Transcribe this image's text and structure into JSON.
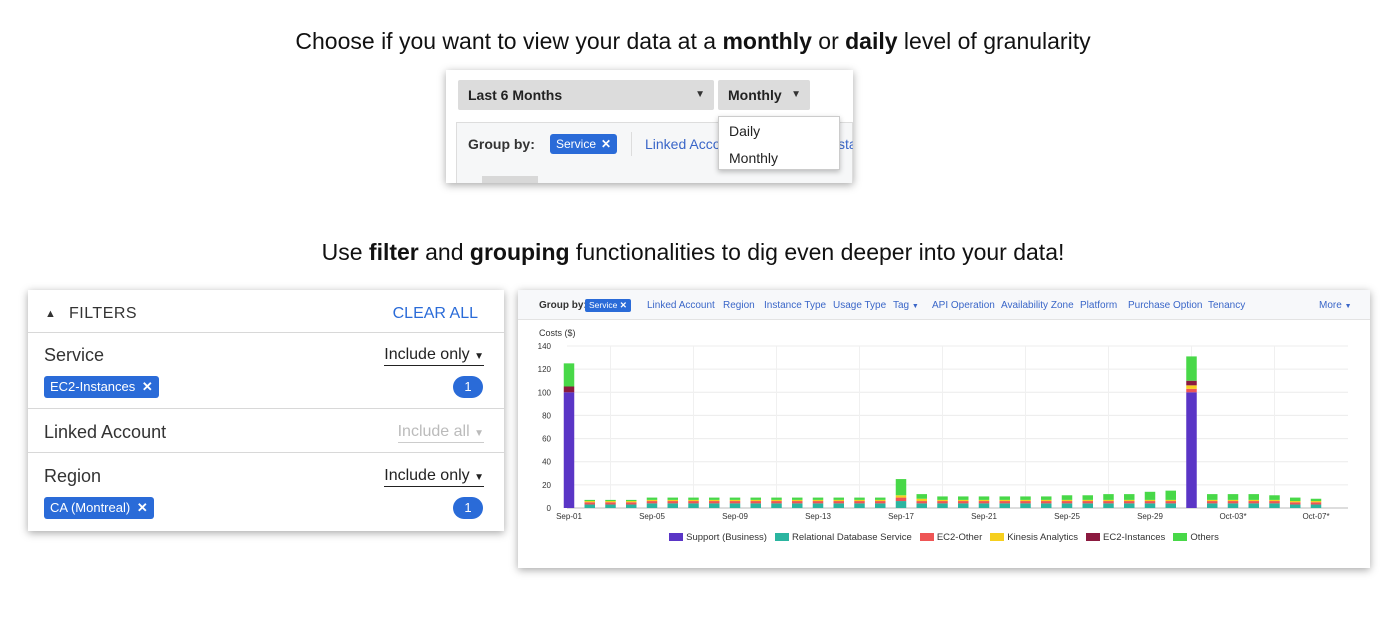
{
  "caption1": {
    "pre": "Choose if you want to view your data at a ",
    "b1": "monthly",
    "mid": " or ",
    "b2": "daily",
    "post": " level of granularity"
  },
  "caption2": {
    "pre": "Use ",
    "b1": "filter",
    "mid": " and ",
    "b2": "grouping",
    "post": " functionalities to dig even deeper into your data!"
  },
  "granularity_panel": {
    "range_label": "Last 6 Months",
    "granularity_label": "Monthly",
    "group_by_label": "Group by:",
    "chip_label": "Service",
    "linked_account_label": "Linked Acco",
    "cut_text": "sta",
    "menu_options": [
      "Daily",
      "Monthly"
    ]
  },
  "filters": {
    "header": "FILTERS",
    "clear_all": "CLEAR ALL",
    "service": {
      "label": "Service",
      "dropdown": "Include only",
      "chip": "EC2-Instances",
      "count": "1"
    },
    "linked_account": {
      "label": "Linked Account",
      "dropdown": "Include all"
    },
    "region": {
      "label": "Region",
      "dropdown": "Include only",
      "chip": "CA (Montreal)",
      "count": "1"
    }
  },
  "chart_toolbar": {
    "group_by_label": "Group by:",
    "chip": "Service",
    "items": [
      "Linked Account",
      "Region",
      "Instance Type",
      "Usage Type",
      "Tag",
      "API Operation",
      "Availability Zone",
      "Platform",
      "Purchase Option",
      "Tenancy"
    ],
    "more": "More"
  },
  "colors": {
    "accent": "#2a6bd8",
    "link": "#3a66c8",
    "support_business": "#5a35c6",
    "relational_database_service": "#2bb5a0",
    "ec2_other": "#ee5555",
    "kinesis_analytics": "#f6cf1e",
    "ec2_instances": "#8b1a3f",
    "others": "#48d848"
  },
  "chart_data": {
    "type": "bar",
    "stacked": true,
    "ylabel": "Costs ($)",
    "ylim": [
      0,
      140
    ],
    "yticks": [
      0,
      20,
      40,
      60,
      80,
      100,
      120,
      140
    ],
    "x_tick_labels": [
      "Sep-01",
      "Sep-05",
      "Sep-09",
      "Sep-13",
      "Sep-17",
      "Sep-21",
      "Sep-25",
      "Sep-29",
      "Oct-03*",
      "Oct-07*"
    ],
    "x_tick_index": [
      0,
      4,
      8,
      12,
      16,
      20,
      24,
      28,
      32,
      36
    ],
    "days": 37,
    "grid": true,
    "legend_position": "bottom",
    "series": [
      {
        "name": "Support (Business)",
        "color": "#5a35c6",
        "values": [
          100,
          0,
          0,
          0,
          0,
          0,
          0,
          0,
          0,
          0,
          0,
          0,
          0,
          0,
          0,
          0,
          0,
          0,
          0,
          0,
          0,
          0,
          0,
          0,
          0,
          0,
          0,
          0,
          0,
          0,
          100,
          0,
          0,
          0,
          0,
          0,
          0
        ]
      },
      {
        "name": "Relational Database Service",
        "color": "#2bb5a0",
        "values": [
          0,
          3,
          3,
          3,
          4,
          4,
          4,
          4,
          4,
          4,
          4,
          4,
          4,
          4,
          4,
          4,
          6,
          4,
          4,
          4,
          4,
          4,
          4,
          4,
          4,
          4,
          4,
          4,
          4,
          4,
          0,
          4,
          4,
          4,
          4,
          3,
          3
        ]
      },
      {
        "name": "EC2-Other",
        "color": "#ee5555",
        "values": [
          0,
          2,
          2,
          2,
          2,
          2,
          2,
          2,
          2,
          2,
          2,
          2,
          2,
          2,
          2,
          2,
          3,
          2,
          2,
          2,
          2,
          2,
          2,
          2,
          2,
          2,
          2,
          2,
          2,
          2,
          3,
          2,
          2,
          2,
          2,
          2,
          2
        ]
      },
      {
        "name": "Kinesis Analytics",
        "color": "#f6cf1e",
        "values": [
          0,
          1,
          1,
          1,
          1,
          1,
          1,
          1,
          1,
          1,
          1,
          1,
          1,
          1,
          1,
          1,
          2,
          2,
          1,
          1,
          1,
          1,
          1,
          1,
          1,
          1,
          1,
          1,
          1,
          1,
          3,
          1,
          1,
          1,
          1,
          1,
          1
        ]
      },
      {
        "name": "EC2-Instances",
        "color": "#8b1a3f",
        "values": [
          5,
          0,
          0,
          0,
          0,
          0,
          0,
          0,
          0,
          0,
          0,
          0,
          0,
          0,
          0,
          0,
          0,
          0,
          0,
          0,
          0,
          0,
          0,
          0,
          0,
          0,
          0,
          0,
          0,
          0,
          4,
          0,
          0,
          0,
          0,
          0,
          0
        ]
      },
      {
        "name": "Others",
        "color": "#48d848",
        "values": [
          20,
          1,
          1,
          1,
          2,
          2,
          2,
          2,
          2,
          2,
          2,
          2,
          2,
          2,
          2,
          2,
          14,
          4,
          3,
          3,
          3,
          3,
          3,
          3,
          4,
          4,
          5,
          5,
          7,
          8,
          21,
          5,
          5,
          5,
          4,
          3,
          2
        ]
      }
    ]
  }
}
